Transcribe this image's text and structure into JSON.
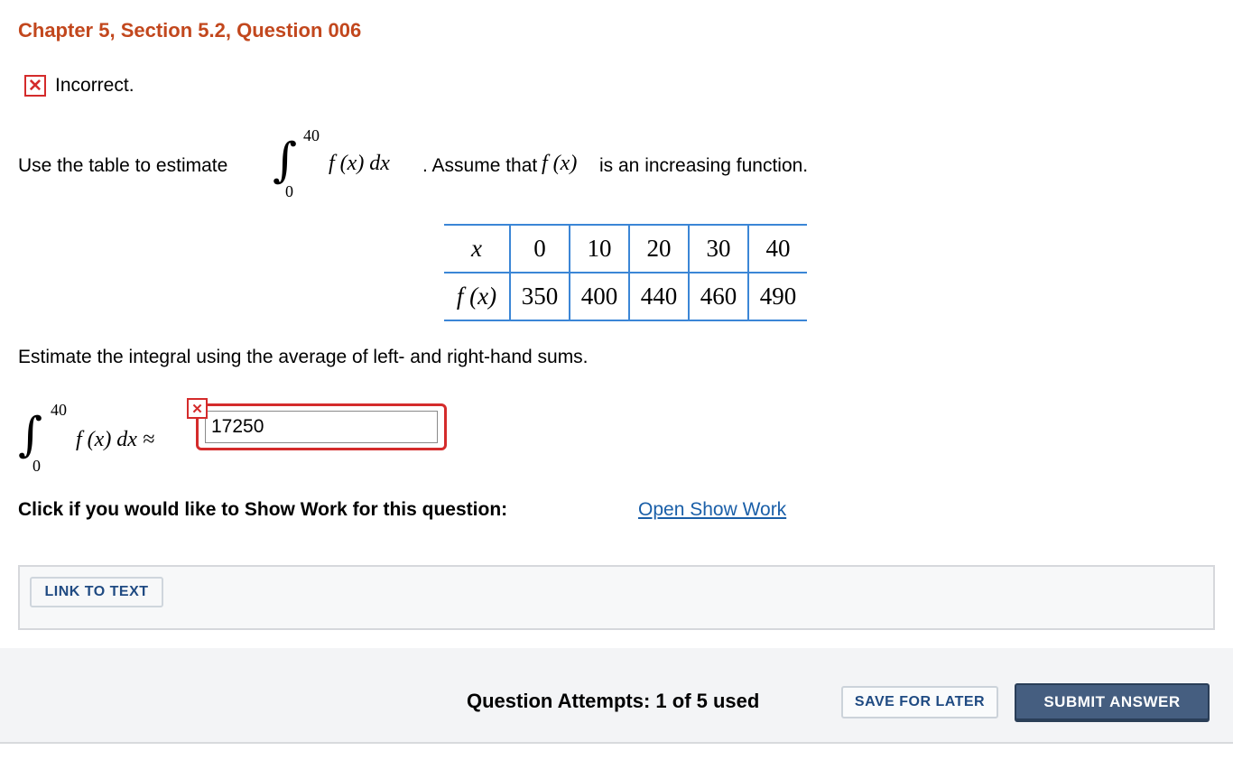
{
  "header": {
    "title": "Chapter 5, Section 5.2, Question 006"
  },
  "result": {
    "icon": "x-mark-icon",
    "text": "Incorrect.",
    "color": "#d42b2b"
  },
  "question": {
    "prompt_start": "Use the table to estimate",
    "integral": {
      "upper": "40",
      "lower": "0",
      "integrand": "f (x) dx"
    },
    "after_integral": ". Assume that",
    "fx": "f (x)",
    "after_fx": "is an increasing function."
  },
  "table": {
    "x_label": "x",
    "fx_label": "f (x)",
    "x_values": [
      "0",
      "10",
      "20",
      "30",
      "40"
    ],
    "fx_values": [
      "350",
      "400",
      "440",
      "460",
      "490"
    ]
  },
  "instruction": "Estimate the integral using the average of left- and right-hand sums.",
  "answer": {
    "integral": {
      "upper": "40",
      "lower": "0",
      "integrand": "f (x) dx ≈"
    },
    "value": "17250",
    "status_icon": "x-mark-icon"
  },
  "show_work": {
    "prompt": "Click if you would like to Show Work for this question:",
    "link": "Open Show Work"
  },
  "resources": {
    "link_to_text": "LINK TO TEXT"
  },
  "footer": {
    "attempts": "Question Attempts: 1 of 5 used",
    "save_label": "SAVE FOR LATER",
    "submit_label": "SUBMIT ANSWER"
  },
  "colors": {
    "title": "#c2471d",
    "error": "#d42b2b",
    "table_border": "#3b86d6",
    "link": "#1a5fa8",
    "submit_bg": "#455e80"
  }
}
